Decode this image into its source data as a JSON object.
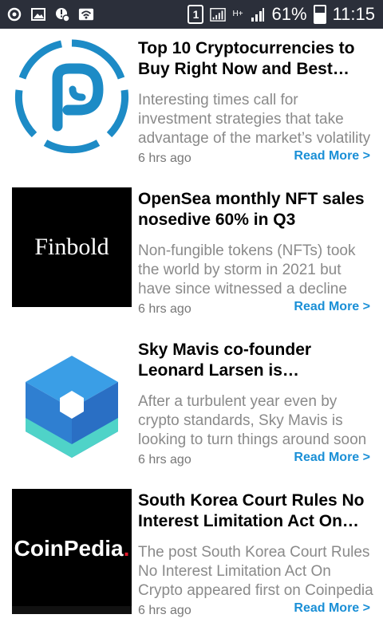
{
  "status_bar": {
    "left_icons": [
      "sync-icon",
      "image-icon",
      "alert-settings-icon",
      "wifi-icon"
    ],
    "sim_badge": "1",
    "network_type": "H+",
    "battery": "61%",
    "battery_level": 0.61,
    "time": "11:15"
  },
  "feed": {
    "items": [
      {
        "title": "Top 10 Cryptocurrencies to Buy Right Now and Best Crypto to Invest",
        "description": "Interesting times call for investment strategies that take advantage of the market’s volatility",
        "time": "6 hrs ago",
        "read_more": "Read More >",
        "thumb": "crypto-logo-icon"
      },
      {
        "title": "OpenSea monthly NFT sales nosedive 60% in Q3",
        "description": "Non-fungible tokens (NFTs) took the world by storm in 2021 but have since witnessed a decline",
        "time": "6 hrs ago",
        "read_more": "Read More >",
        "thumb_text": "Finbold"
      },
      {
        "title": "Sky Mavis co-founder Leonard Larsen is determined to rebuild",
        "description": "After a turbulent year even by crypto standards, Sky Mavis is looking to turn things around soon",
        "time": "6 hrs ago",
        "read_more": "Read More >",
        "thumb": "hexagon-logo-icon"
      },
      {
        "title": "South Korea Court Rules No Interest Limitation Act On Crypto",
        "description": "The post South Korea Court Rules No Interest Limitation Act On Crypto appeared first on Coinpedia",
        "time": "6 hrs ago",
        "read_more": "Read More >",
        "thumb_text": "CoinPedia",
        "thumb_dot": "."
      }
    ]
  }
}
